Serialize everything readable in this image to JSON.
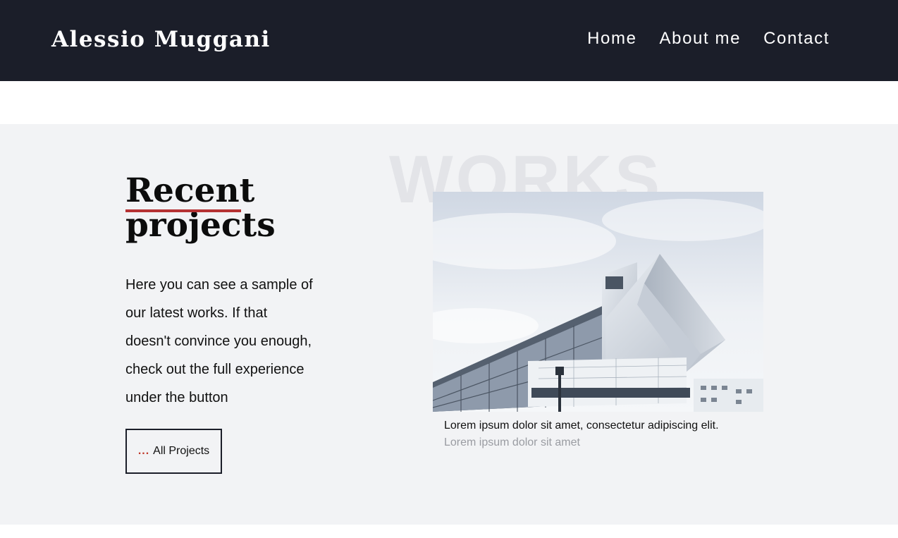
{
  "header": {
    "brand": "Alessio Muggani",
    "nav": [
      {
        "label": "Home"
      },
      {
        "label": "About me"
      },
      {
        "label": "Contact"
      }
    ]
  },
  "section": {
    "watermark": "WORKS",
    "heading_line1": "Recent",
    "heading_line2": "projects",
    "description": "Here you can see a sample of our latest works. If that doesn't convince you enough, check out the full experience under the button",
    "button": {
      "prefix": "...",
      "label": "All Projects"
    },
    "project": {
      "image_alt": "Modern angular white building with glass facade",
      "title": "Lorem ipsum dolor sit amet, consectetur adipiscing elit.",
      "subtitle": "Lorem ipsum dolor sit amet"
    }
  },
  "colors": {
    "header_bg": "#1b1e29",
    "section_bg": "#f2f3f5",
    "accent": "#b53233"
  }
}
